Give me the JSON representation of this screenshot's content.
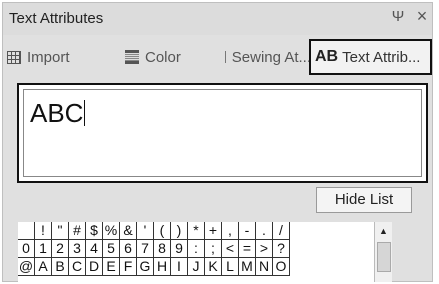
{
  "window": {
    "title": "Text Attributes",
    "pin_glyph": "Ψ",
    "close_glyph": "×"
  },
  "tabs": [
    {
      "label": "Import",
      "icon": "import-grid-icon"
    },
    {
      "label": "Color",
      "icon": "thread-spool-icon"
    },
    {
      "label": "Sewing At...",
      "icon": "stitch-icon"
    },
    {
      "label": "Text Attrib...",
      "icon": "ab-text-icon",
      "icon_text": "AB",
      "active": true
    }
  ],
  "text_field": {
    "value": "ABC"
  },
  "hide_list_label": "Hide List",
  "char_rows": [
    [
      " ",
      "!",
      "\"",
      "#",
      "$",
      "%",
      "&",
      "'",
      "(",
      ")",
      "*",
      "+",
      ",",
      "-",
      ".",
      "/"
    ],
    [
      "0",
      "1",
      "2",
      "3",
      "4",
      "5",
      "6",
      "7",
      "8",
      "9",
      ":",
      ";",
      "<",
      "=",
      ">",
      "?"
    ],
    [
      "@",
      "A",
      "B",
      "C",
      "D",
      "E",
      "F",
      "G",
      "H",
      "I",
      "J",
      "K",
      "L",
      "M",
      "N",
      "O"
    ]
  ],
  "scrollbar": {
    "up_arrow": "▲"
  }
}
